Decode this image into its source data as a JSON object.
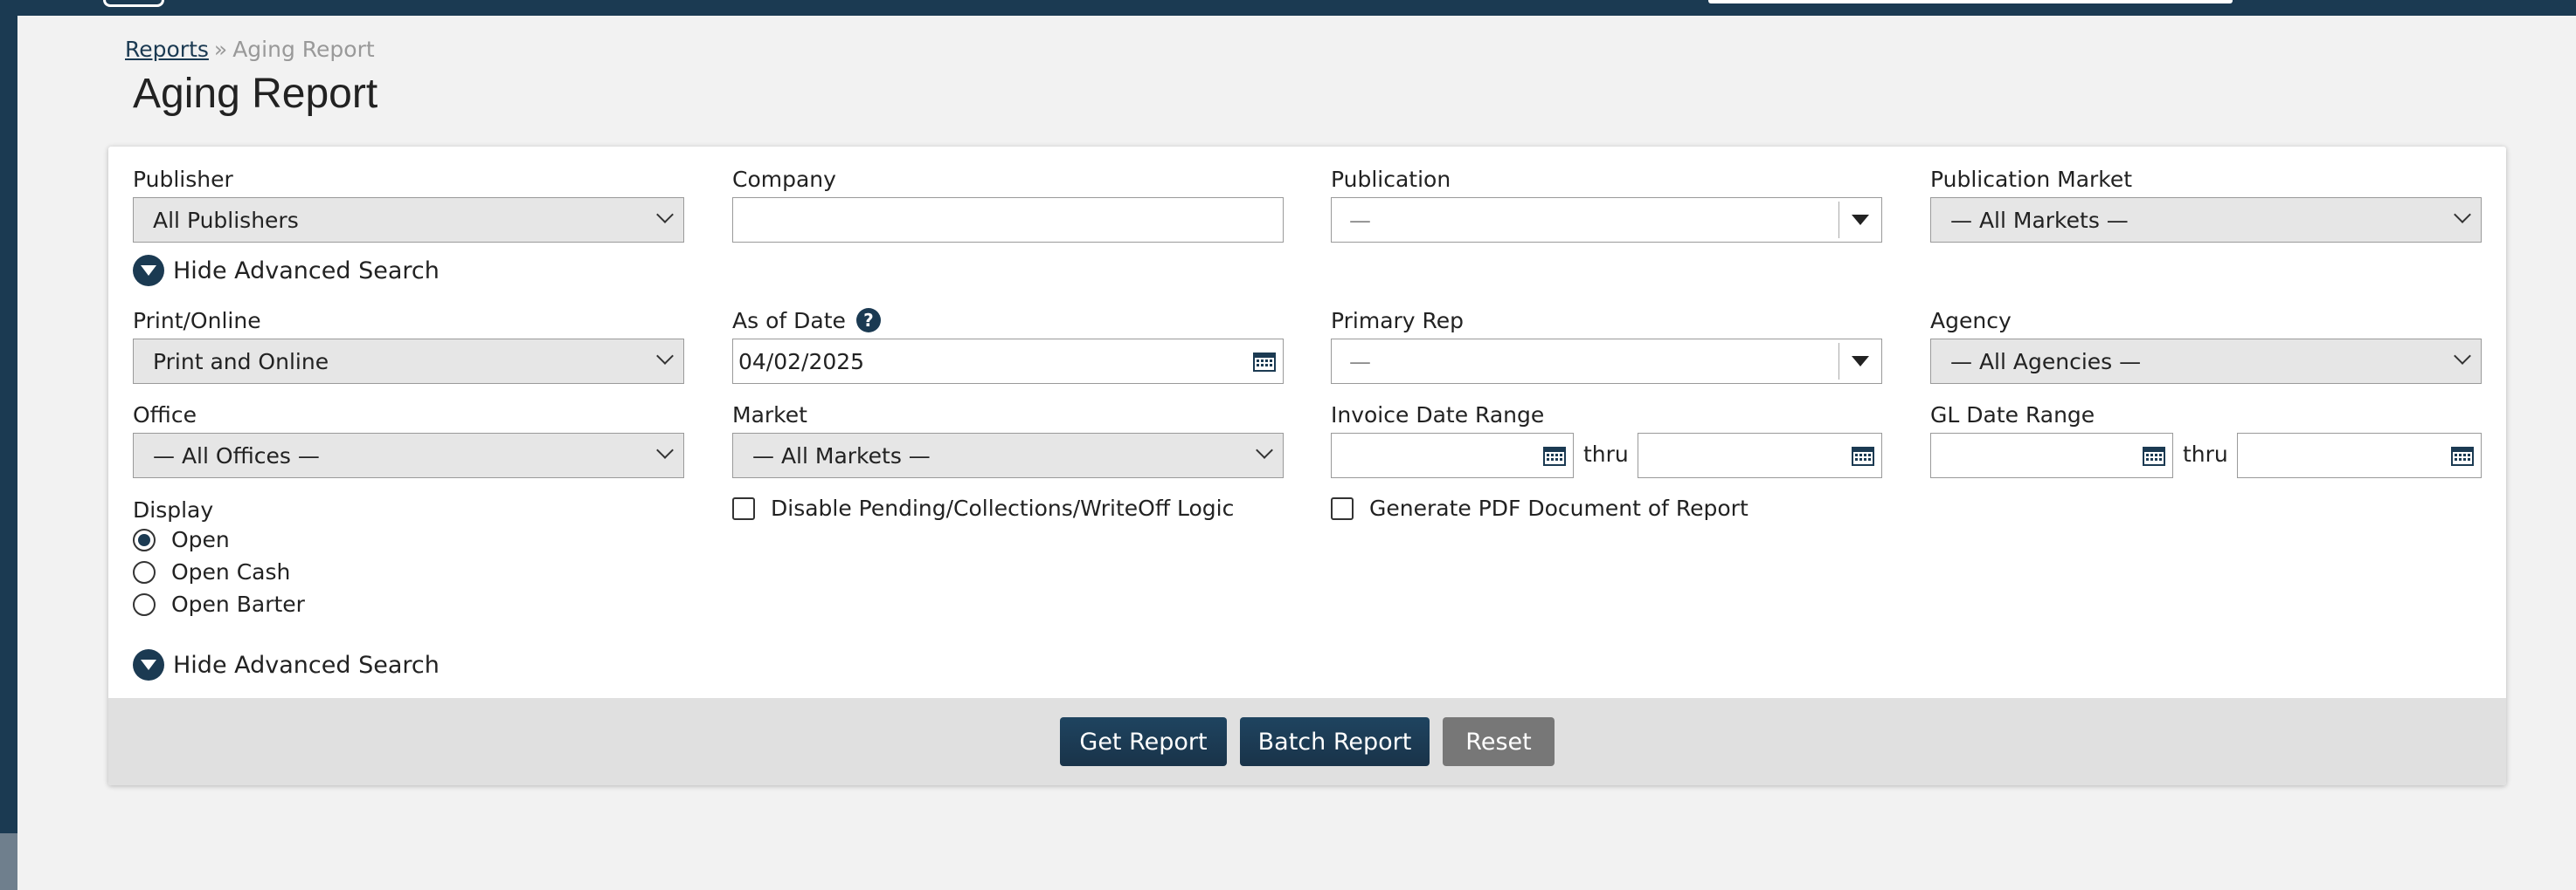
{
  "breadcrumb": {
    "parent": "Reports",
    "separator": "»",
    "current": "Aging Report"
  },
  "page_title": "Aging Report",
  "fields": {
    "publisher": {
      "label": "Publisher",
      "value": "All Publishers"
    },
    "company": {
      "label": "Company",
      "value": ""
    },
    "publication": {
      "label": "Publication",
      "value": "—"
    },
    "publication_market": {
      "label": "Publication Market",
      "value": "— All Markets —"
    },
    "print_online": {
      "label": "Print/Online",
      "value": "Print and Online"
    },
    "as_of_date": {
      "label": "As of Date",
      "value": "04/02/2025",
      "help": "?"
    },
    "primary_rep": {
      "label": "Primary Rep",
      "value": "—"
    },
    "agency": {
      "label": "Agency",
      "value": "— All Agencies —"
    },
    "office": {
      "label": "Office",
      "value": "— All Offices —"
    },
    "market": {
      "label": "Market",
      "value": "— All Markets —"
    },
    "invoice_date_range": {
      "label": "Invoice Date Range",
      "thru": "thru"
    },
    "gl_date_range": {
      "label": "GL Date Range",
      "thru": "thru"
    }
  },
  "advanced_toggle": "Hide Advanced Search",
  "display": {
    "label": "Display",
    "options": [
      {
        "label": "Open",
        "checked": true
      },
      {
        "label": "Open Cash",
        "checked": false
      },
      {
        "label": "Open Barter",
        "checked": false
      }
    ]
  },
  "checkboxes": {
    "disable_logic": "Disable Pending/Collections/WriteOff Logic",
    "generate_pdf": "Generate PDF Document of Report"
  },
  "buttons": {
    "get_report": "Get Report",
    "batch_report": "Batch Report",
    "reset": "Reset"
  },
  "colors": {
    "brand": "#1b3a52",
    "panel": "#ffffff",
    "footer": "#e0e0e0",
    "reset": "#777777"
  }
}
